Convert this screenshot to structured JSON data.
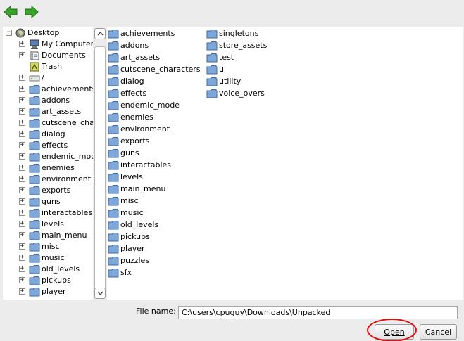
{
  "toolbar": {
    "back_icon": "back-arrow-icon",
    "forward_icon": "forward-arrow-icon",
    "arrow_color": "#3aa32c"
  },
  "tree": {
    "root": {
      "label": "Desktop",
      "icon": "desktop-icon",
      "expander": "−"
    },
    "places": [
      {
        "label": "My Computer",
        "icon": "computer-icon",
        "expander": "+"
      },
      {
        "label": "Documents",
        "icon": "documents-icon",
        "expander": "+"
      },
      {
        "label": "Trash",
        "icon": "trash-icon",
        "expander": ""
      },
      {
        "label": "/",
        "icon": "drive-icon",
        "expander": "+"
      }
    ],
    "folders": [
      "achievements",
      "addons",
      "art_assets",
      "cutscene_chara",
      "dialog",
      "effects",
      "endemic_mode",
      "enemies",
      "environment",
      "exports",
      "guns",
      "interactables",
      "levels",
      "main_menu",
      "misc",
      "music",
      "old_levels",
      "pickups",
      "player"
    ]
  },
  "files": {
    "column1": [
      "achievements",
      "addons",
      "art_assets",
      "cutscene_characters",
      "dialog",
      "effects",
      "endemic_mode",
      "enemies",
      "environment",
      "exports",
      "guns",
      "interactables",
      "levels",
      "main_menu",
      "misc",
      "music",
      "old_levels",
      "pickups",
      "player",
      "puzzles",
      "sfx"
    ],
    "column2": [
      "singletons",
      "store_assets",
      "test",
      "ui",
      "utility",
      "voice_overs"
    ]
  },
  "filename": {
    "label": "File name:",
    "value": "C:\\users\\cpuguy\\Downloads\\Unpacked"
  },
  "buttons": {
    "open": "Open",
    "cancel": "Cancel"
  },
  "colors": {
    "highlight_ring": "#e01010",
    "folder_fill": "#7fa7d8",
    "folder_stroke": "#3c6aa3"
  }
}
